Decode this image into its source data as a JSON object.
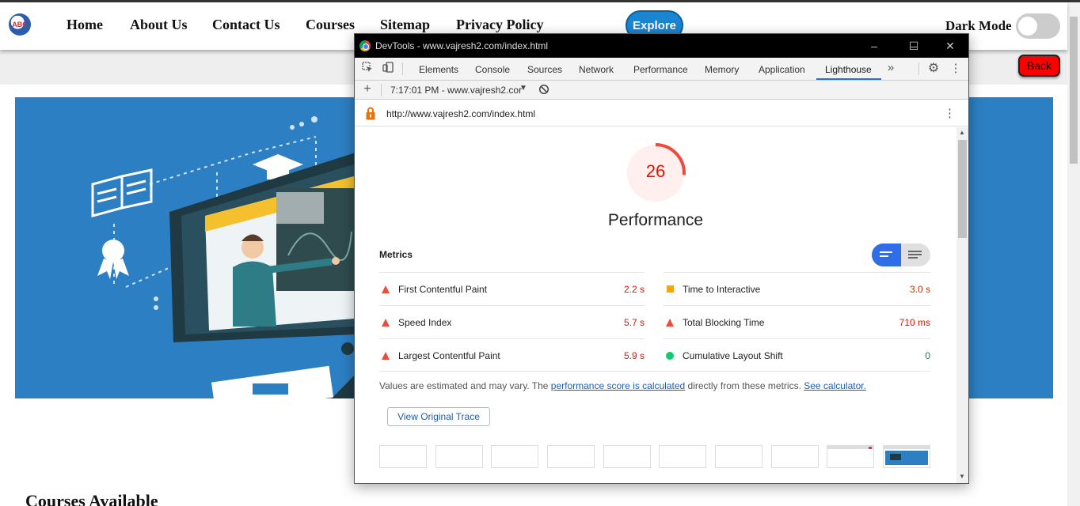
{
  "site": {
    "logo_text": "ABC",
    "nav": [
      "Home",
      "About Us",
      "Contact Us",
      "Courses",
      "Sitemap",
      "Privacy Policy"
    ],
    "explore_label": "Explore",
    "dark_mode_label": "Dark Mode",
    "dark_mode_on": false,
    "back_label": "Back",
    "courses_heading": "Courses Available"
  },
  "devtools": {
    "window_title": "DevTools - www.vajresh2.com/index.html",
    "tabs": [
      "Elements",
      "Console",
      "Sources",
      "Network",
      "Performance",
      "Memory",
      "Application",
      "Lighthouse"
    ],
    "active_tab": "Lighthouse",
    "overflow_glyph": "»",
    "report_selector": "7:17:01 PM - www.vajresh2.cor",
    "url": "http://www.vajresh2.com/index.html",
    "score": "26",
    "score_fraction": 0.26,
    "category_title": "Performance",
    "metrics_label": "Metrics",
    "metrics_left": [
      {
        "label": "First Contentful Paint",
        "value": "2.2 s",
        "status": "fail"
      },
      {
        "label": "Speed Index",
        "value": "5.7 s",
        "status": "fail"
      },
      {
        "label": "Largest Contentful Paint",
        "value": "5.9 s",
        "status": "fail"
      }
    ],
    "metrics_right": [
      {
        "label": "Time to Interactive",
        "value": "3.0 s",
        "status": "average"
      },
      {
        "label": "Total Blocking Time",
        "value": "710 ms",
        "status": "fail"
      },
      {
        "label": "Cumulative Layout Shift",
        "value": "0",
        "status": "pass"
      }
    ],
    "note_prefix": "Values are estimated and may vary. The ",
    "note_link1": "performance score is calculated",
    "note_middle": " directly from these metrics. ",
    "note_link2": "See calculator.",
    "trace_button": "View Original Trace"
  },
  "colors": {
    "fail": "#eb0f00",
    "average": "#c33300",
    "pass": "#018642",
    "accent": "#1a73e8",
    "hero_bg": "#2d7fc3",
    "back_btn": "#ff0000",
    "explore_btn": "#1a85d1"
  }
}
